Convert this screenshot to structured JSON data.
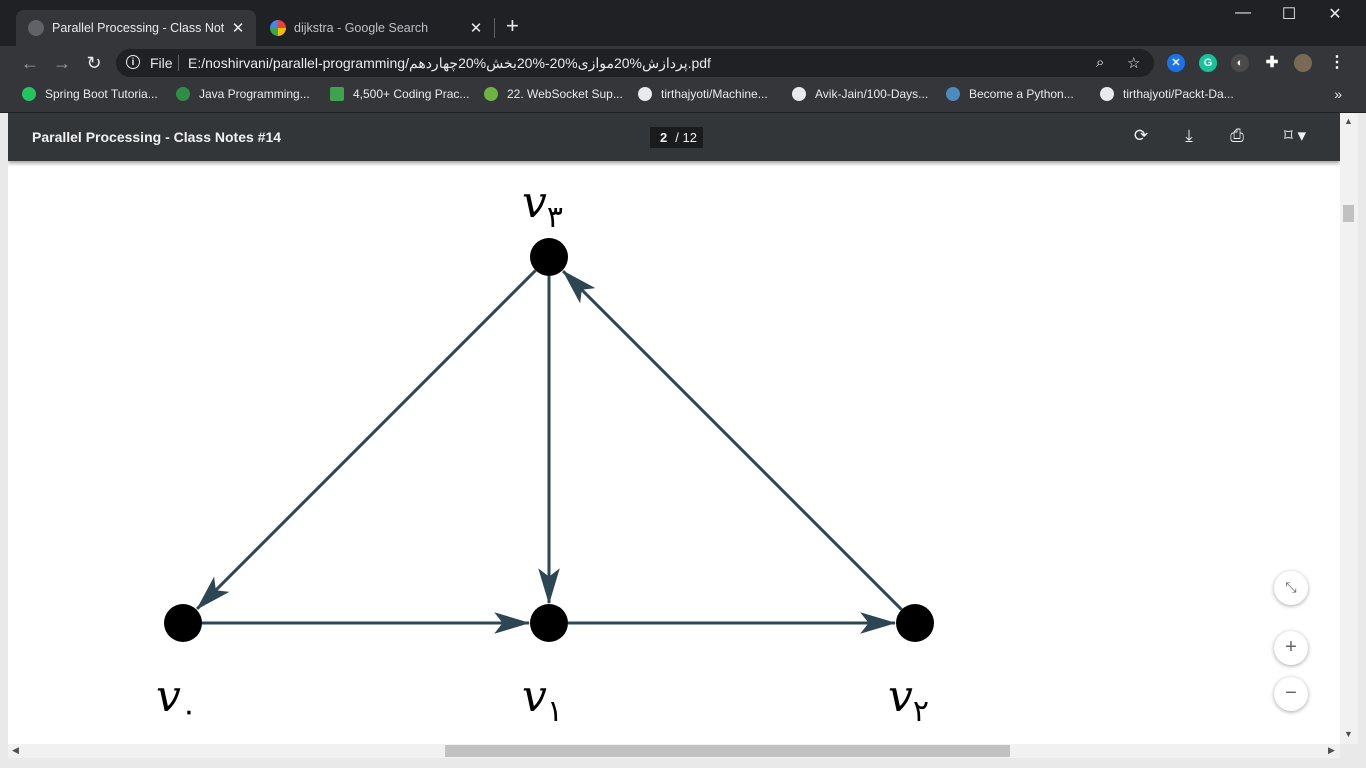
{
  "tabs": [
    {
      "title": "Parallel Processing - Class Notes",
      "close": "✕"
    },
    {
      "title": "dijkstra - Google Search",
      "close": "✕"
    }
  ],
  "new_tab": "+",
  "window": {
    "minimize": "—",
    "maximize": "☐",
    "close": "✕"
  },
  "toolbar": {
    "back": "←",
    "forward": "→",
    "reload": "↻",
    "scheme": "File",
    "url": "E:/noshirvani/parallel-programming/پردازش%20موازی%20-%20بخش%20چهاردهم.pdf"
  },
  "bookmarks": [
    {
      "label": "Spring Boot Tutoria...",
      "icon": "spring-icon",
      "color": "#22c55e"
    },
    {
      "label": "Java Programming...",
      "icon": "gfg-icon",
      "color": "#2f8d46"
    },
    {
      "label": "4,500+ Coding Prac...",
      "icon": "codewars-icon",
      "color": "#3fa34d"
    },
    {
      "label": "22. WebSocket Sup...",
      "icon": "spring-leaf-icon",
      "color": "#6db33f"
    },
    {
      "label": "tirthajyoti/Machine...",
      "icon": "github-icon",
      "color": "#e8eaed"
    },
    {
      "label": "Avik-Jain/100-Days...",
      "icon": "github-icon",
      "color": "#e8eaed"
    },
    {
      "label": "Become a Python...",
      "icon": "python-icon",
      "color": "#4b8bbe"
    },
    {
      "label": "tirthajyoti/Packt-Da...",
      "icon": "github-icon",
      "color": "#e8eaed"
    }
  ],
  "bookmarks_more": "»",
  "pdf": {
    "title": "Parallel Processing - Class Notes #14",
    "current_page": "2",
    "total_pages": "/ 12",
    "zoom_fit": "⤡",
    "zoom_in": "+",
    "zoom_out": "−"
  },
  "graph": {
    "nodes": [
      {
        "id": "v0",
        "base": "v",
        "sub": "۰"
      },
      {
        "id": "v1",
        "base": "v",
        "sub": "۱"
      },
      {
        "id": "v2",
        "base": "v",
        "sub": "۲"
      },
      {
        "id": "v3",
        "base": "v",
        "sub": "۳"
      }
    ],
    "edges": [
      {
        "from": "v3",
        "to": "v0"
      },
      {
        "from": "v3",
        "to": "v1"
      },
      {
        "from": "v2",
        "to": "v3"
      },
      {
        "from": "v0",
        "to": "v1"
      },
      {
        "from": "v1",
        "to": "v2"
      }
    ],
    "node_color": "#000000",
    "edge_color": "#2c4654"
  },
  "colors": {
    "chrome_dark": "#202124",
    "chrome_mid": "#35363a",
    "pdf_bar": "#323639",
    "page": "#ffffff"
  }
}
